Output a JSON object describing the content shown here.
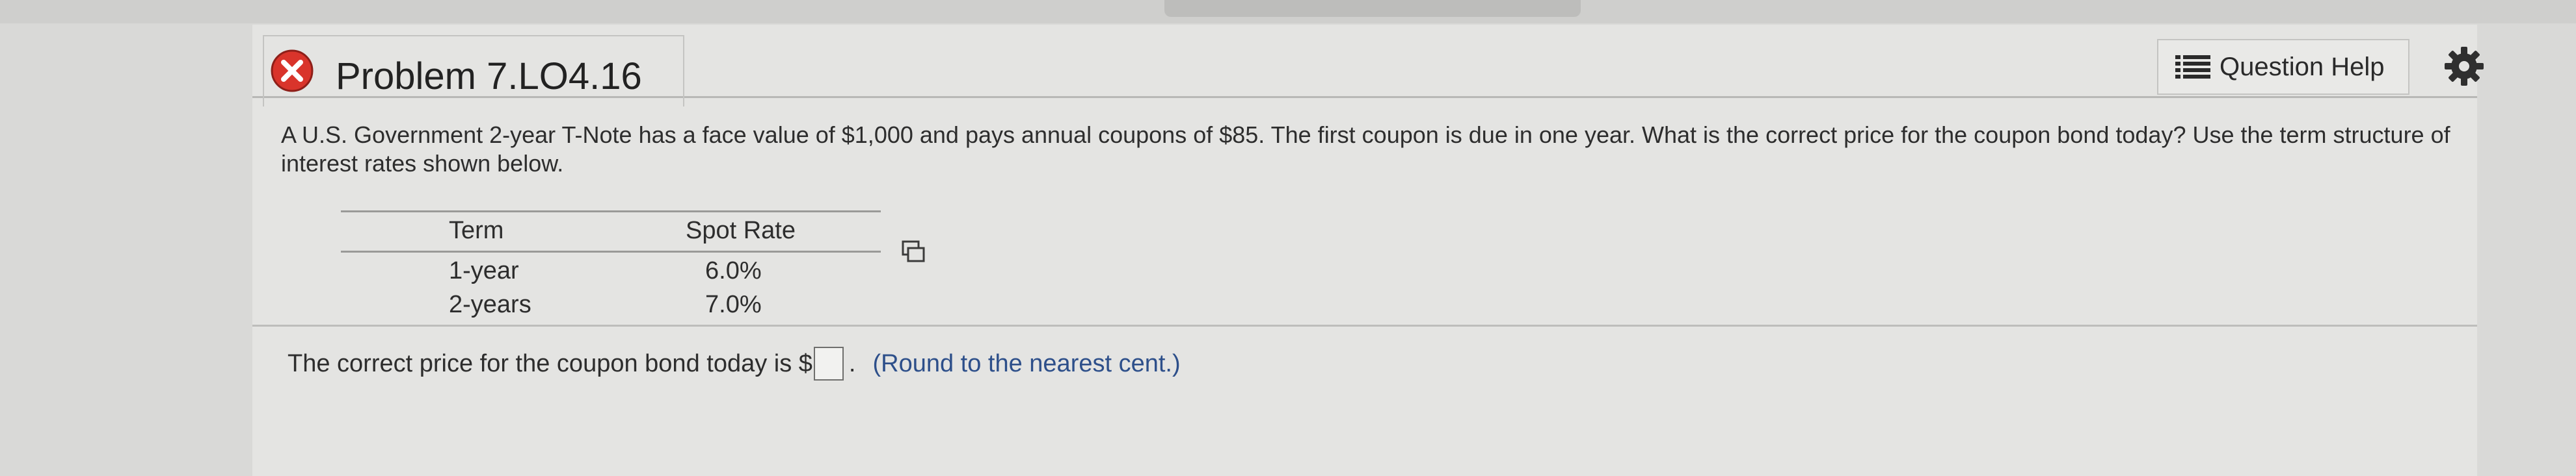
{
  "header": {
    "title": "Problem 7.LO4.16",
    "help_label": "Question Help"
  },
  "question": {
    "text": "A U.S. Government 2-year T-Note has a face value of $1,000 and pays annual coupons of $85.  The first coupon is due in one year.  What is the correct price for the coupon bond today?  Use the term structure of interest rates shown below."
  },
  "table": {
    "headers": [
      "Term",
      "Spot Rate"
    ],
    "rows": [
      [
        "1-year",
        "6.0%"
      ],
      [
        "2-years",
        "7.0%"
      ]
    ]
  },
  "answer": {
    "prefix": "The correct price for the coupon bond today is $",
    "suffix": ".",
    "value": "",
    "note": "(Round to the nearest cent.)"
  },
  "colors": {
    "error_icon": "#d9342b",
    "link_blue": "#2d4f8a"
  },
  "icons": [
    "close-x-icon",
    "list-icon",
    "gear-icon",
    "copy-icon"
  ]
}
